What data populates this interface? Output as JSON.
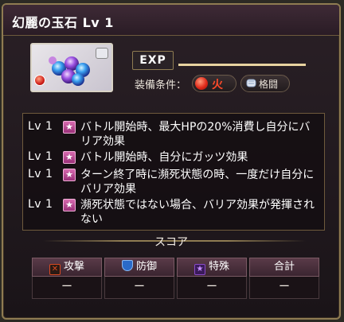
{
  "header": {
    "title": "幻麗の玉石 Lv 1"
  },
  "exp": {
    "label": "EXP"
  },
  "equip": {
    "label": "装備条件：",
    "element": "火",
    "attack_type": "格闘"
  },
  "skills": [
    {
      "level": "Lv 1",
      "text": "バトル開始時、最大HPの20%消費し自分にバリア効果"
    },
    {
      "level": "Lv 1",
      "text": "バトル開始時、自分にガッツ効果"
    },
    {
      "level": "Lv 1",
      "text": "ターン終了時に瀕死状態の時、一度だけ自分にバリア効果"
    },
    {
      "level": "Lv 1",
      "text": "瀕死状態ではない場合、バリア効果が発揮されない"
    }
  ],
  "score": {
    "label": "スコア",
    "columns": [
      {
        "label": "攻撃",
        "value": "ー",
        "icon": "sword-icon"
      },
      {
        "label": "防御",
        "value": "ー",
        "icon": "shield-icon"
      },
      {
        "label": "特殊",
        "value": "ー",
        "icon": "star-icon"
      },
      {
        "label": "合計",
        "value": "ー"
      }
    ]
  },
  "colors": {
    "frame": "#8f7c52",
    "fire": "#ff4a2a",
    "skill_star": "#c0509a",
    "attack_icon": "#d84a20",
    "defense_icon": "#2a6ac8",
    "special_icon": "#8a4ac8"
  }
}
